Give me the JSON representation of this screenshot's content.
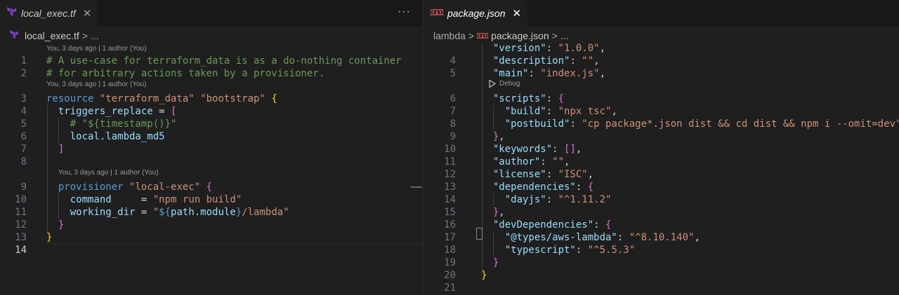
{
  "left": {
    "tab": {
      "label": "local_exec.tf",
      "close": "✕"
    },
    "more": "···",
    "breadcrumb": {
      "file": "local_exec.tf",
      "sep": ">",
      "tail": "..."
    },
    "lens": [
      "You, 3 days ago | 1 author (You)",
      "You, 3 days ago | 1 author (You)",
      "You, 3 days ago | 1 author (You)"
    ],
    "lines": [
      {
        "n": "1",
        "t": [
          [
            "c",
            "# A use-case for terraform_data is as a do-nothing container"
          ]
        ]
      },
      {
        "n": "2",
        "t": [
          [
            "c",
            "# for arbitrary actions taken by a provisioner."
          ]
        ]
      },
      {
        "n": "3",
        "t": [
          [
            "k",
            "resource"
          ],
          [
            "d",
            " "
          ],
          [
            "s",
            "\"terraform_data\""
          ],
          [
            "d",
            " "
          ],
          [
            "s",
            "\"bootstrap\""
          ],
          [
            "d",
            " "
          ],
          [
            "p1",
            "{"
          ]
        ]
      },
      {
        "n": "4",
        "t": [
          [
            "d",
            "  "
          ],
          [
            "v",
            "triggers_replace"
          ],
          [
            "d",
            " = "
          ],
          [
            "p2",
            "["
          ]
        ]
      },
      {
        "n": "5",
        "t": [
          [
            "d",
            "    "
          ],
          [
            "c",
            "# \"${timestamp()}\""
          ]
        ]
      },
      {
        "n": "6",
        "t": [
          [
            "d",
            "    "
          ],
          [
            "v",
            "local.lambda_md5"
          ]
        ]
      },
      {
        "n": "7",
        "t": [
          [
            "d",
            "  "
          ],
          [
            "p2",
            "]"
          ]
        ]
      },
      {
        "n": "8",
        "t": []
      },
      {
        "n": "9",
        "t": [
          [
            "d",
            "  "
          ],
          [
            "k",
            "provisioner"
          ],
          [
            "d",
            " "
          ],
          [
            "s",
            "\"local-exec\""
          ],
          [
            "d",
            " "
          ],
          [
            "p2",
            "{"
          ]
        ]
      },
      {
        "n": "10",
        "t": [
          [
            "d",
            "    "
          ],
          [
            "v",
            "command"
          ],
          [
            "d",
            "     = "
          ],
          [
            "s",
            "\"npm run build\""
          ]
        ]
      },
      {
        "n": "11",
        "t": [
          [
            "d",
            "    "
          ],
          [
            "v",
            "working_dir"
          ],
          [
            "d",
            " = "
          ],
          [
            "s",
            "\""
          ],
          [
            "k",
            "${"
          ],
          [
            "v",
            "path.module"
          ],
          [
            "k",
            "}"
          ],
          [
            "s",
            "/lambda\""
          ]
        ]
      },
      {
        "n": "12",
        "t": [
          [
            "d",
            "  "
          ],
          [
            "p2",
            "}"
          ]
        ]
      },
      {
        "n": "13",
        "t": [
          [
            "p1",
            "}"
          ]
        ]
      },
      {
        "n": "14",
        "t": []
      }
    ]
  },
  "right": {
    "tab": {
      "label": "package.json",
      "close": "✕"
    },
    "breadcrumb": {
      "folder": "lambda",
      "sep": ">",
      "file": "package.json",
      "tail": "..."
    },
    "debug_lens": "Debug",
    "lines": [
      {
        "n": "",
        "t": [
          [
            "d",
            "  "
          ],
          [
            "v",
            "\"version\""
          ],
          [
            "d",
            ": "
          ],
          [
            "s",
            "\"1.0.0\""
          ],
          [
            "d",
            ","
          ]
        ]
      },
      {
        "n": "4",
        "t": [
          [
            "d",
            "  "
          ],
          [
            "v",
            "\"description\""
          ],
          [
            "d",
            ": "
          ],
          [
            "s",
            "\"\""
          ],
          [
            "d",
            ","
          ]
        ]
      },
      {
        "n": "5",
        "t": [
          [
            "d",
            "  "
          ],
          [
            "v",
            "\"main\""
          ],
          [
            "d",
            ": "
          ],
          [
            "s",
            "\"index.js\""
          ],
          [
            "d",
            ","
          ]
        ]
      },
      {
        "n": "6",
        "t": [
          [
            "d",
            "  "
          ],
          [
            "v",
            "\"scripts\""
          ],
          [
            "d",
            ": "
          ],
          [
            "p2",
            "{"
          ]
        ]
      },
      {
        "n": "7",
        "t": [
          [
            "d",
            "    "
          ],
          [
            "v",
            "\"build\""
          ],
          [
            "d",
            ": "
          ],
          [
            "s",
            "\"npx tsc\""
          ],
          [
            "d",
            ","
          ]
        ]
      },
      {
        "n": "8",
        "t": [
          [
            "d",
            "    "
          ],
          [
            "v",
            "\"postbuild\""
          ],
          [
            "d",
            ": "
          ],
          [
            "s",
            "\"cp package*.json dist && cd dist && npm i --omit=dev\""
          ]
        ]
      },
      {
        "n": "9",
        "t": [
          [
            "d",
            "  "
          ],
          [
            "p2",
            "}"
          ],
          [
            "d",
            ","
          ]
        ]
      },
      {
        "n": "10",
        "t": [
          [
            "d",
            "  "
          ],
          [
            "v",
            "\"keywords\""
          ],
          [
            "d",
            ": "
          ],
          [
            "p2",
            "[]"
          ],
          [
            "d",
            ","
          ]
        ]
      },
      {
        "n": "11",
        "t": [
          [
            "d",
            "  "
          ],
          [
            "v",
            "\"author\""
          ],
          [
            "d",
            ": "
          ],
          [
            "s",
            "\"\""
          ],
          [
            "d",
            ","
          ]
        ]
      },
      {
        "n": "12",
        "t": [
          [
            "d",
            "  "
          ],
          [
            "v",
            "\"license\""
          ],
          [
            "d",
            ": "
          ],
          [
            "s",
            "\"ISC\""
          ],
          [
            "d",
            ","
          ]
        ]
      },
      {
        "n": "13",
        "t": [
          [
            "d",
            "  "
          ],
          [
            "v",
            "\"dependencies\""
          ],
          [
            "d",
            ": "
          ],
          [
            "p2",
            "{"
          ]
        ]
      },
      {
        "n": "14",
        "t": [
          [
            "d",
            "    "
          ],
          [
            "v",
            "\"dayjs\""
          ],
          [
            "d",
            ": "
          ],
          [
            "s",
            "\"^1.11.2\""
          ]
        ]
      },
      {
        "n": "15",
        "t": [
          [
            "d",
            "  "
          ],
          [
            "p2",
            "}"
          ],
          [
            "d",
            ","
          ]
        ]
      },
      {
        "n": "16",
        "t": [
          [
            "d",
            "  "
          ],
          [
            "v",
            "\"devDependencies\""
          ],
          [
            "d",
            ": "
          ],
          [
            "p2",
            "{"
          ]
        ]
      },
      {
        "n": "17",
        "t": [
          [
            "d",
            "    "
          ],
          [
            "v",
            "\"@types/aws-lambda\""
          ],
          [
            "d",
            ": "
          ],
          [
            "s",
            "\"^8.10.140\""
          ],
          [
            "d",
            ","
          ]
        ]
      },
      {
        "n": "18",
        "t": [
          [
            "d",
            "    "
          ],
          [
            "v",
            "\"typescript\""
          ],
          [
            "d",
            ": "
          ],
          [
            "s",
            "\"^5.5.3\""
          ]
        ]
      },
      {
        "n": "19",
        "t": [
          [
            "d",
            "  "
          ],
          [
            "p2",
            "}"
          ]
        ]
      },
      {
        "n": "20",
        "t": [
          [
            "p1",
            "}"
          ]
        ]
      },
      {
        "n": "21",
        "t": []
      }
    ]
  },
  "colors": {
    "editor_bg": "#1f1f1f",
    "tabbar_bg": "#181818",
    "terraform_icon": "#7b42bc",
    "json_icon": "#e05a5a",
    "keyword": "#569cd6",
    "string": "#ce9178",
    "comment": "#6a9955",
    "property": "#9cdcfe",
    "bracket_gold": "#ffd700",
    "bracket_pink": "#da70d6"
  }
}
